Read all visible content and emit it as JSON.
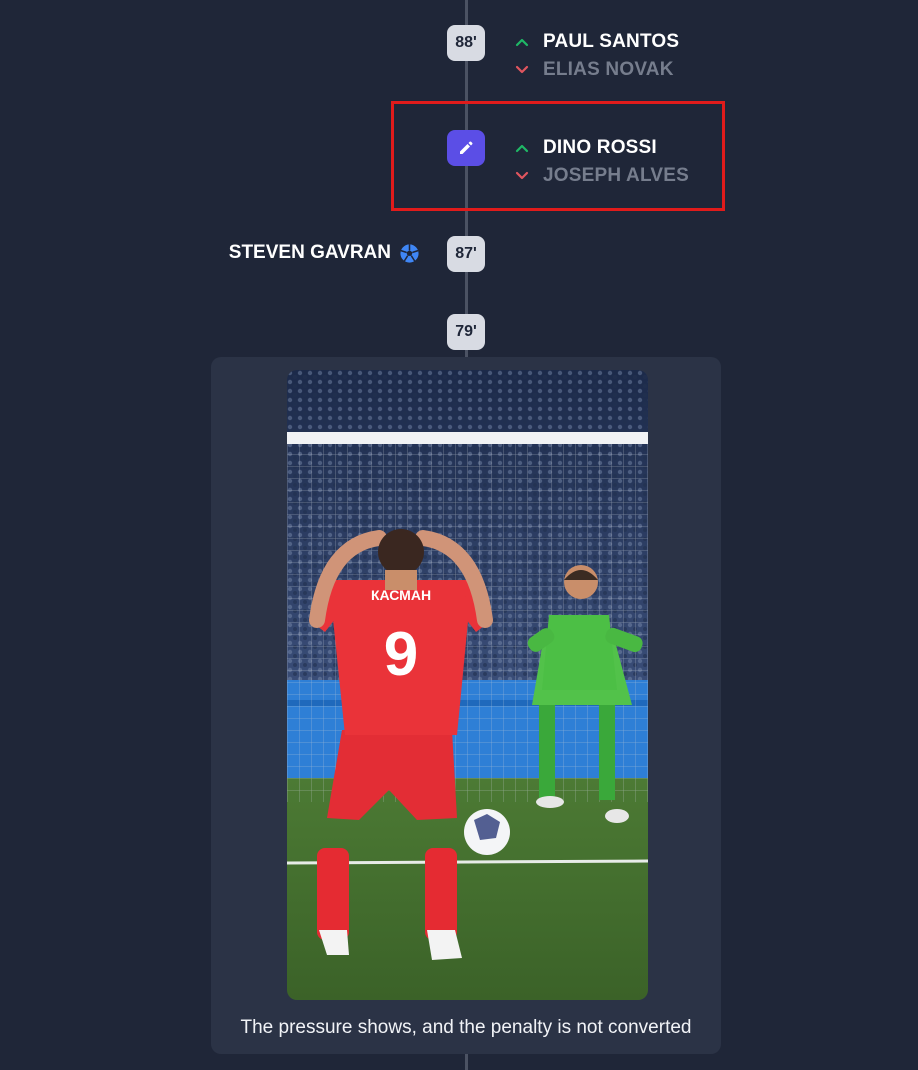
{
  "events": [
    {
      "minute": "88'",
      "type": "substitution",
      "player_in": "PAUL SANTOS",
      "player_out": "ELIAS NOVAK"
    },
    {
      "minute": "",
      "type": "substitution",
      "icon": "pencil-icon",
      "player_in": "DINO ROSSI",
      "player_out": "JOSEPH ALVES"
    },
    {
      "minute": "87'",
      "type": "goal",
      "scorer": "STEVEN GAVRAN",
      "icon": "soccer-ball-icon"
    },
    {
      "minute": "79'",
      "type": "media",
      "caption": "The pressure shows, and the penalty is not converted"
    }
  ],
  "colors": {
    "background": "#1f2638",
    "card": "#2b3346",
    "edit_accent": "#5b4ee6",
    "sub_in": "#1fb866",
    "sub_out": "#e0555f",
    "highlight": "#e01b1b"
  }
}
